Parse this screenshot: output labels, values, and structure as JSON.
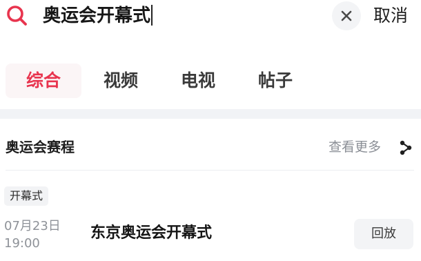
{
  "search": {
    "query": "奥运会开幕式",
    "cancel_label": "取消",
    "icon": "search-icon",
    "clear_icon": "close-icon",
    "accent_color": "#e8344e"
  },
  "tabs": [
    {
      "label": "综合",
      "active": true
    },
    {
      "label": "视频",
      "active": false
    },
    {
      "label": "电视",
      "active": false
    },
    {
      "label": "帖子",
      "active": false
    }
  ],
  "section": {
    "title": "奥运会赛程",
    "more_label": "查看更多",
    "more_icon": "share-nodes-icon"
  },
  "event": {
    "tag": "开幕式",
    "date": "07月23日",
    "time": "19:00",
    "title": "东京奥运会开幕式",
    "action_label": "回放"
  }
}
